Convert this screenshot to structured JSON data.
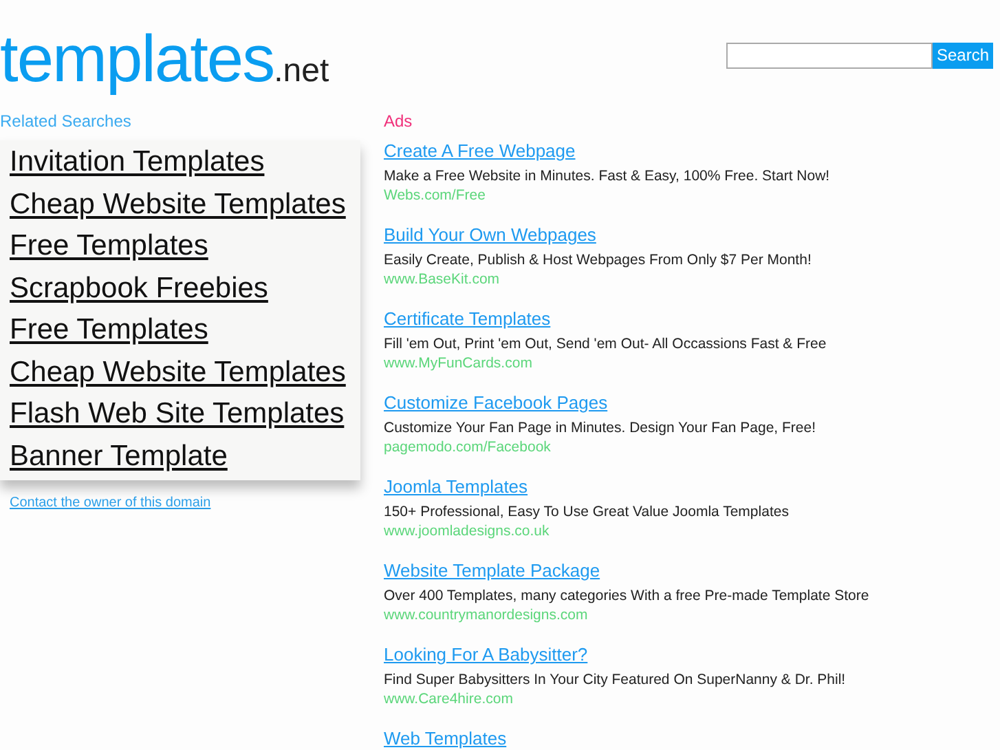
{
  "logo": {
    "name": "templates",
    "suffix": ".net"
  },
  "search": {
    "button": "Search"
  },
  "related": {
    "heading": "Related Searches",
    "items": [
      "Invitation Templates",
      "Cheap Website Templates",
      "Free Templates",
      "Scrapbook Freebies",
      "Free Templates",
      "Cheap Website Templates",
      "Flash Web Site Templates",
      "Banner Template"
    ],
    "contact": "Contact the owner of this domain"
  },
  "ads": {
    "heading": "Ads",
    "items": [
      {
        "title": "Create A Free Webpage",
        "text": "Make a Free Website in Minutes. Fast & Easy, 100% Free. Start Now!",
        "url": "Webs.com/Free"
      },
      {
        "title": "Build Your Own Webpages",
        "text": "Easily Create, Publish & Host Webpages From Only $7 Per Month!",
        "url": "www.BaseKit.com"
      },
      {
        "title": "Certificate Templates",
        "text": "Fill 'em Out, Print 'em Out, Send 'em Out- All Occassions Fast & Free",
        "url": "www.MyFunCards.com"
      },
      {
        "title": "Customize Facebook Pages",
        "text": "Customize Your Fan Page in Minutes. Design Your Fan Page, Free!",
        "url": "pagemodo.com/Facebook"
      },
      {
        "title": "Joomla Templates",
        "text": "150+ Professional, Easy To Use Great Value Joomla Templates",
        "url": "www.joomladesigns.co.uk"
      },
      {
        "title": "Website Template Package",
        "text": "Over 400 Templates, many categories With a free Pre-made Template Store",
        "url": "www.countrymanordesigns.com"
      },
      {
        "title": "Looking For A Babysitter?",
        "text": "Find Super Babysitters In Your City Featured On SuperNanny & Dr. Phil!",
        "url": "www.Care4hire.com"
      },
      {
        "title": "Web Templates"
      }
    ]
  }
}
